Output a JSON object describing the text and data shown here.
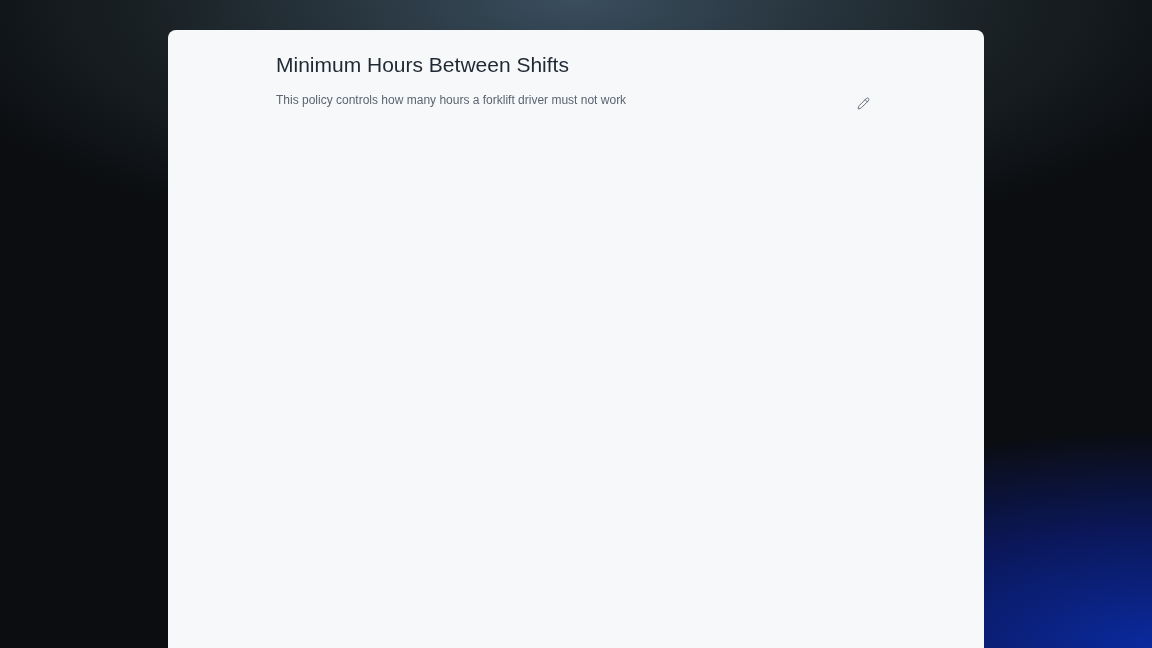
{
  "policy": {
    "title": "Minimum Hours Between Shifts",
    "description": "This policy controls how many hours a forklift driver must not work"
  }
}
